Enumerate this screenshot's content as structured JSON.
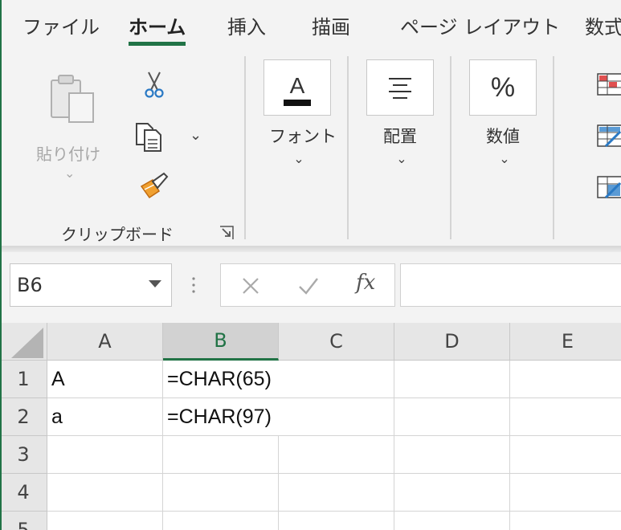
{
  "tabs": [
    {
      "label": "ファイル",
      "active": false
    },
    {
      "label": "ホーム",
      "active": true
    },
    {
      "label": "挿入",
      "active": false
    },
    {
      "label": "描画",
      "active": false
    },
    {
      "label": "ページ レイアウト",
      "active": false
    },
    {
      "label": "数式",
      "active": false
    }
  ],
  "ribbon": {
    "clipboard": {
      "paste_label": "貼り付け",
      "group_label": "クリップボード"
    },
    "font": {
      "icon_letter": "A",
      "label": "フォント"
    },
    "alignment": {
      "label": "配置"
    },
    "number": {
      "icon_symbol": "%",
      "label": "数値"
    }
  },
  "formula_bar": {
    "name_box": "B6",
    "fx": "fx",
    "formula": ""
  },
  "grid": {
    "columns": [
      "A",
      "B",
      "C",
      "D",
      "E"
    ],
    "selected_column": "B",
    "rows": [
      "1",
      "2",
      "3",
      "4",
      "5"
    ],
    "cells": {
      "A1": "A",
      "B1": "=CHAR(65)",
      "A2": "a",
      "B2": "=CHAR(97)"
    }
  },
  "colors": {
    "accent": "#217346",
    "ribbon_bg": "#f3f3f3",
    "header_bg": "#e6e6e6"
  }
}
